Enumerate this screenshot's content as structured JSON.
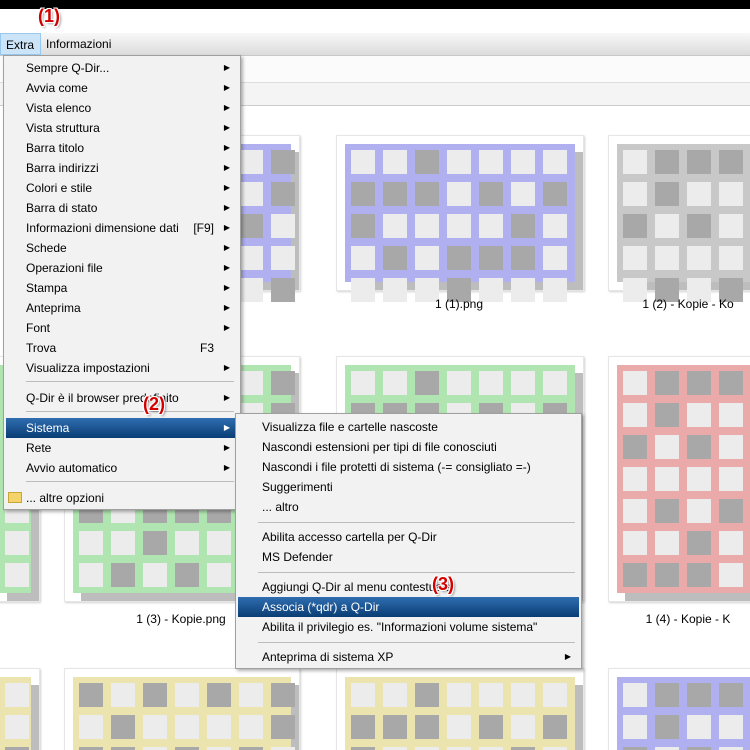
{
  "menubar": {
    "items": [
      "Extra",
      "Informazioni"
    ]
  },
  "annotations": [
    "(1)",
    "(2)",
    "(3)"
  ],
  "extra_menu": {
    "items": [
      {
        "label": "Sempre Q-Dir...",
        "submenu": true
      },
      {
        "label": "Avvia come",
        "submenu": true
      },
      {
        "label": "Vista elenco",
        "submenu": true
      },
      {
        "label": "Vista struttura",
        "submenu": true
      },
      {
        "label": "Barra titolo",
        "submenu": true
      },
      {
        "label": "Barra indirizzi",
        "submenu": true
      },
      {
        "label": "Colori e stile",
        "submenu": true
      },
      {
        "label": "Barra di stato",
        "submenu": true
      },
      {
        "label": "Informazioni dimensione dati",
        "shortcut": "[F9]",
        "submenu": true
      },
      {
        "label": "Schede",
        "submenu": true
      },
      {
        "label": "Operazioni file",
        "submenu": true
      },
      {
        "label": "Stampa",
        "submenu": true
      },
      {
        "label": "Anteprima",
        "submenu": true
      },
      {
        "label": "Font",
        "submenu": true
      },
      {
        "label": "Trova",
        "shortcut": "F3",
        "submenu": false
      },
      {
        "label": "Visualizza impostazioni",
        "submenu": true
      },
      {
        "label": "Q-Dir è il browser predefinito",
        "submenu": true
      },
      {
        "label": "Sistema",
        "submenu": true
      },
      {
        "label": "Rete",
        "submenu": true
      },
      {
        "label": "Avvio automatico",
        "submenu": true
      },
      {
        "label": "... altre opzioni",
        "submenu": false
      }
    ]
  },
  "sistema_menu": {
    "items": [
      {
        "label": "Visualizza file e cartelle nascoste"
      },
      {
        "label": "Nascondi estensioni per tipi di file conosciuti"
      },
      {
        "label": "Nascondi i file protetti di sistema (-= consigliato =-)"
      },
      {
        "label": "Suggerimenti"
      },
      {
        "label": "... altro"
      },
      {
        "label": "Abilita accesso cartella per Q-Dir"
      },
      {
        "label": "MS Defender"
      },
      {
        "label": "Aggiungi Q-Dir al menu contestuale"
      },
      {
        "label": "Associa (*qdr) a Q-Dir"
      },
      {
        "label": "Abilita il privilegio es. \"Informazioni volume sistema\""
      },
      {
        "label": "Anteprima di sistema XP",
        "submenu": true
      }
    ]
  },
  "files": {
    "labels": [
      "1 (1).png",
      "1 (2) - Kopie - Ko",
      "1 (3) - Kopie.png",
      "1 (4) - Kopie - K"
    ]
  },
  "colors": {
    "purple": "#b0b0f0",
    "gray": "#c8c8c8",
    "green": "#b0e4b0",
    "red": "#eaaaaa",
    "yellow": "#ece4ae",
    "highlight": "#0b4f8c",
    "annotation": "#d40000"
  },
  "icons": {
    "arrow": "▶"
  }
}
